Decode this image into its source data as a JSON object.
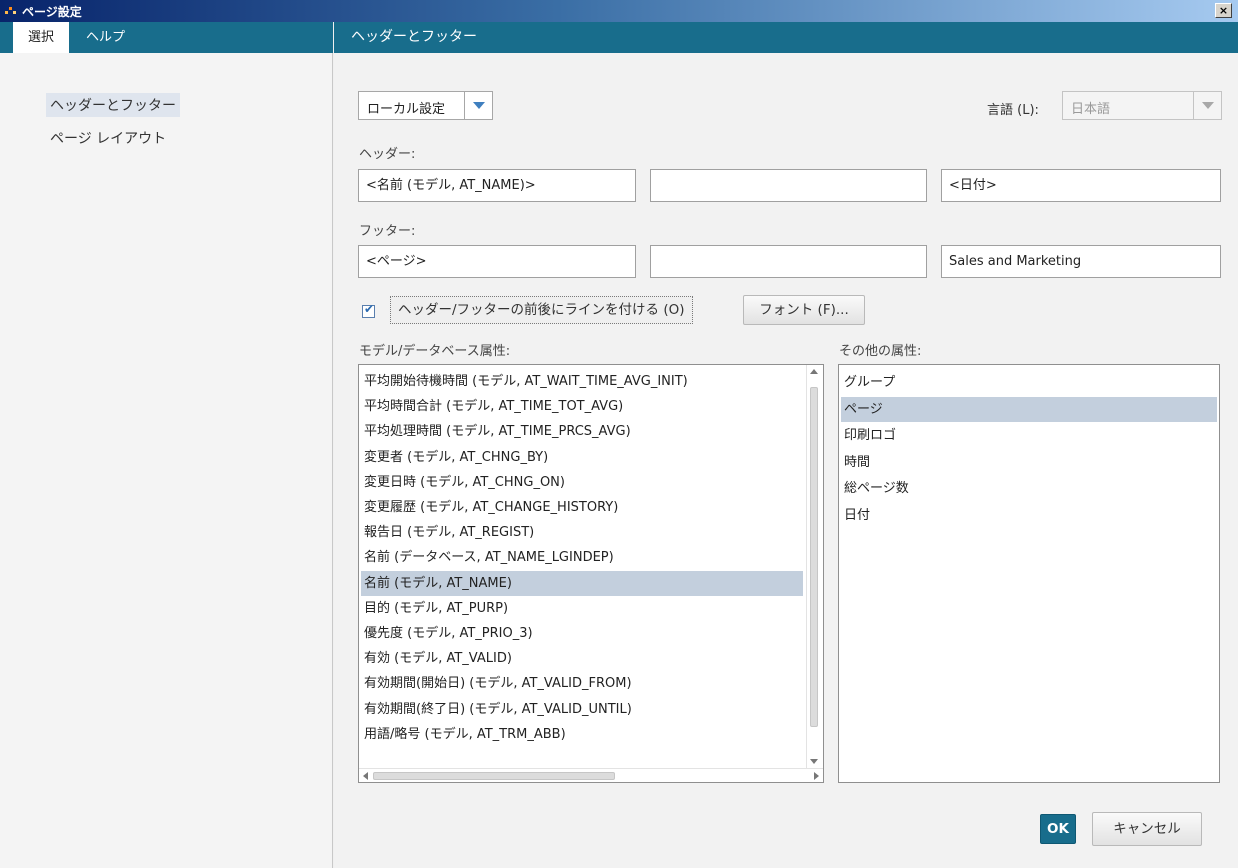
{
  "window": {
    "title": "ページ設定",
    "close_glyph": "×"
  },
  "left_tabs": [
    {
      "label": "選択"
    },
    {
      "label": "ヘルプ"
    }
  ],
  "nav": [
    {
      "label": "ヘッダーとフッター"
    },
    {
      "label": "ページ レイアウト"
    }
  ],
  "panel": {
    "title": "ヘッダーとフッター"
  },
  "settings_combo": {
    "value": "ローカル設定"
  },
  "language": {
    "label": "言語 (L):",
    "value": "日本語"
  },
  "header": {
    "label": "ヘッダー:",
    "left": "<名前 (モデル, AT_NAME)>",
    "center": "",
    "right": "<日付>"
  },
  "footer": {
    "label": "フッター:",
    "left": "<ページ>",
    "center": "",
    "right": "Sales and Marketing"
  },
  "line_option": {
    "label": "ヘッダー/フッターの前後にラインを付ける (O)",
    "checked": true
  },
  "font_button": {
    "label": "フォント (F)..."
  },
  "model_attrs": {
    "label": "モデル/データベース属性:",
    "items": [
      "平均開始待機時間 (モデル, AT_WAIT_TIME_AVG_INIT)",
      "平均時間合計 (モデル, AT_TIME_TOT_AVG)",
      "平均処理時間 (モデル, AT_TIME_PRCS_AVG)",
      "変更者 (モデル, AT_CHNG_BY)",
      "変更日時 (モデル, AT_CHNG_ON)",
      "変更履歴 (モデル, AT_CHANGE_HISTORY)",
      "報告日 (モデル, AT_REGIST)",
      "名前 (データベース, AT_NAME_LGINDEP)",
      "名前 (モデル, AT_NAME)",
      "目的 (モデル, AT_PURP)",
      "優先度 (モデル, AT_PRIO_3)",
      "有効 (モデル, AT_VALID)",
      "有効期間(開始日) (モデル, AT_VALID_FROM)",
      "有効期間(終了日) (モデル, AT_VALID_UNTIL)",
      "用語/略号 (モデル, AT_TRM_ABB)"
    ],
    "selected_index": 8
  },
  "other_attrs": {
    "label": "その他の属性:",
    "items": [
      "グループ",
      "ページ",
      "印刷ロゴ",
      "時間",
      "総ページ数",
      "日付"
    ],
    "selected_index": 1
  },
  "buttons": {
    "ok": "OK",
    "cancel": "キャンセル"
  },
  "colors": {
    "accent": "#186d8c",
    "selection": "#c3cfdd",
    "title_bar": "#08246b"
  }
}
